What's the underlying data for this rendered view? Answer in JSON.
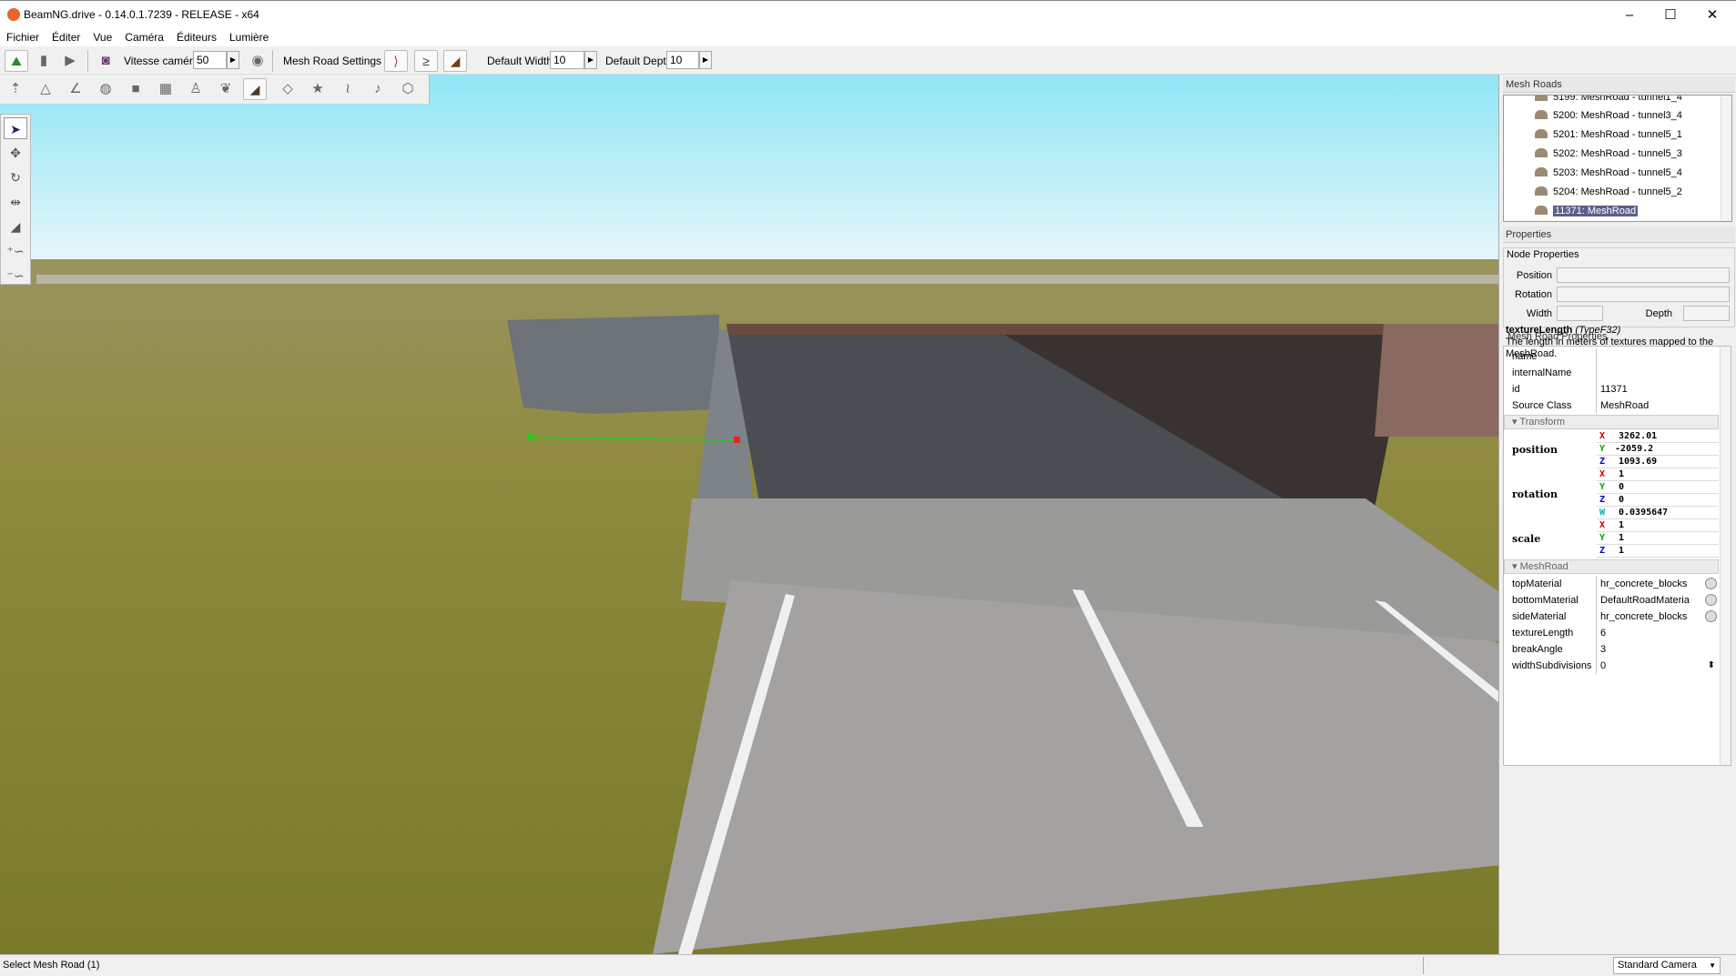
{
  "window": {
    "title": "BeamNG.drive - 0.14.0.1.7239 - RELEASE - x64",
    "minimize": "–",
    "maximize": "☐",
    "close": "✕"
  },
  "menu": [
    "Fichier",
    "Éditer",
    "Vue",
    "Caméra",
    "Éditeurs",
    "Lumière"
  ],
  "toolbar": {
    "camera_speed_label": "Vitesse caméra",
    "camera_speed": "50",
    "mesh_road_settings": "Mesh Road Settings",
    "default_width_label": "Default Width",
    "default_width": "10",
    "default_depth_label": "Default Depth",
    "default_depth": "10"
  },
  "mesh_roads": {
    "title": "Mesh Roads",
    "items": [
      "5199: MeshRoad - tunnel1_4",
      "5200: MeshRoad - tunnel3_4",
      "5201: MeshRoad - tunnel5_1",
      "5202: MeshRoad - tunnel5_3",
      "5203: MeshRoad - tunnel5_4",
      "5204: MeshRoad - tunnel5_2",
      "11371: MeshRoad"
    ],
    "selected": "11371: MeshRoad"
  },
  "properties": {
    "title": "Properties",
    "node_title": "Node Properties",
    "position_label": "Position",
    "rotation_label": "Rotation",
    "width_label": "Width",
    "depth_label": "Depth",
    "mesh_road_props_title": "Mesh Road Properties",
    "tooltip": {
      "name": "textureLength",
      "type": "(TypeF32)",
      "desc": "The length in meters of textures mapped to the MeshRoad."
    },
    "general": [
      {
        "k": "name",
        "v": ""
      },
      {
        "k": "internalName",
        "v": ""
      },
      {
        "k": "id",
        "v": "11371"
      },
      {
        "k": "Source Class",
        "v": "MeshRoad"
      }
    ],
    "transform_title": "Transform",
    "position": {
      "label": "position",
      "x": "3262.01",
      "y": "-2059.2",
      "z": "1093.69"
    },
    "rotation": {
      "label": "rotation",
      "x": "1",
      "y": "0",
      "z": "0",
      "w": "0.0395647"
    },
    "scale": {
      "label": "scale",
      "x": "1",
      "y": "1",
      "z": "1"
    },
    "meshroad_title": "MeshRoad",
    "meshroad": [
      {
        "k": "topMaterial",
        "v": "hr_concrete_blocks"
      },
      {
        "k": "bottomMaterial",
        "v": "DefaultRoadMateria"
      },
      {
        "k": "sideMaterial",
        "v": "hr_concrete_blocks"
      },
      {
        "k": "textureLength",
        "v": "6"
      },
      {
        "k": "breakAngle",
        "v": "3"
      },
      {
        "k": "widthSubdivisions",
        "v": "0"
      }
    ]
  },
  "status": {
    "text": "Select Mesh Road (1)",
    "camera": "Standard Camera"
  },
  "colors": {
    "axis_x": "#cc0000",
    "axis_y": "#00aa00",
    "axis_z": "#0000cc",
    "axis_w": "#00aaaa",
    "selection": "#5a5f8a"
  }
}
